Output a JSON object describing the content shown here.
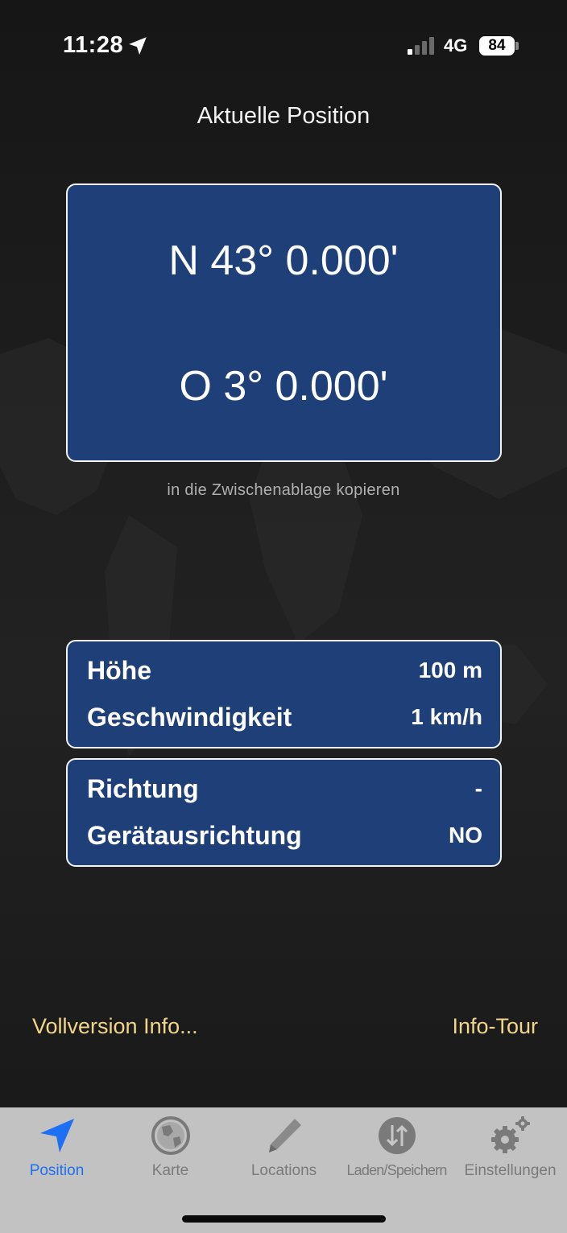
{
  "status_bar": {
    "time": "11:28",
    "network": "4G",
    "battery": "84"
  },
  "page": {
    "title": "Aktuelle Position"
  },
  "coordinates": {
    "latitude": "N 43° 0.000'",
    "longitude": "O 3° 0.000'",
    "copy_label": "in die Zwischenablage kopieren"
  },
  "stats": [
    {
      "label": "Höhe",
      "value": "100 m"
    },
    {
      "label": "Geschwindigkeit",
      "value": "1 km/h"
    }
  ],
  "heading": [
    {
      "label": "Richtung",
      "value": "-"
    },
    {
      "label": "Gerätausrichtung",
      "value": "NO"
    }
  ],
  "links": {
    "full_version": "Vollversion Info...",
    "tour": "Info-Tour"
  },
  "tabs": [
    {
      "label": "Position",
      "icon": "location-arrow-icon",
      "active": true
    },
    {
      "label": "Karte",
      "icon": "globe-icon",
      "active": false
    },
    {
      "label": "Locations",
      "icon": "pencil-icon",
      "active": false
    },
    {
      "label": "Laden/Speichern",
      "icon": "load-save-icon",
      "active": false
    },
    {
      "label": "Einstellungen",
      "icon": "gear-icon",
      "active": false
    }
  ],
  "colors": {
    "card": "#1f3f78",
    "link": "#f0d58a",
    "active_tab": "#1f6ff2",
    "tab_bar": "#c2c2c2"
  }
}
